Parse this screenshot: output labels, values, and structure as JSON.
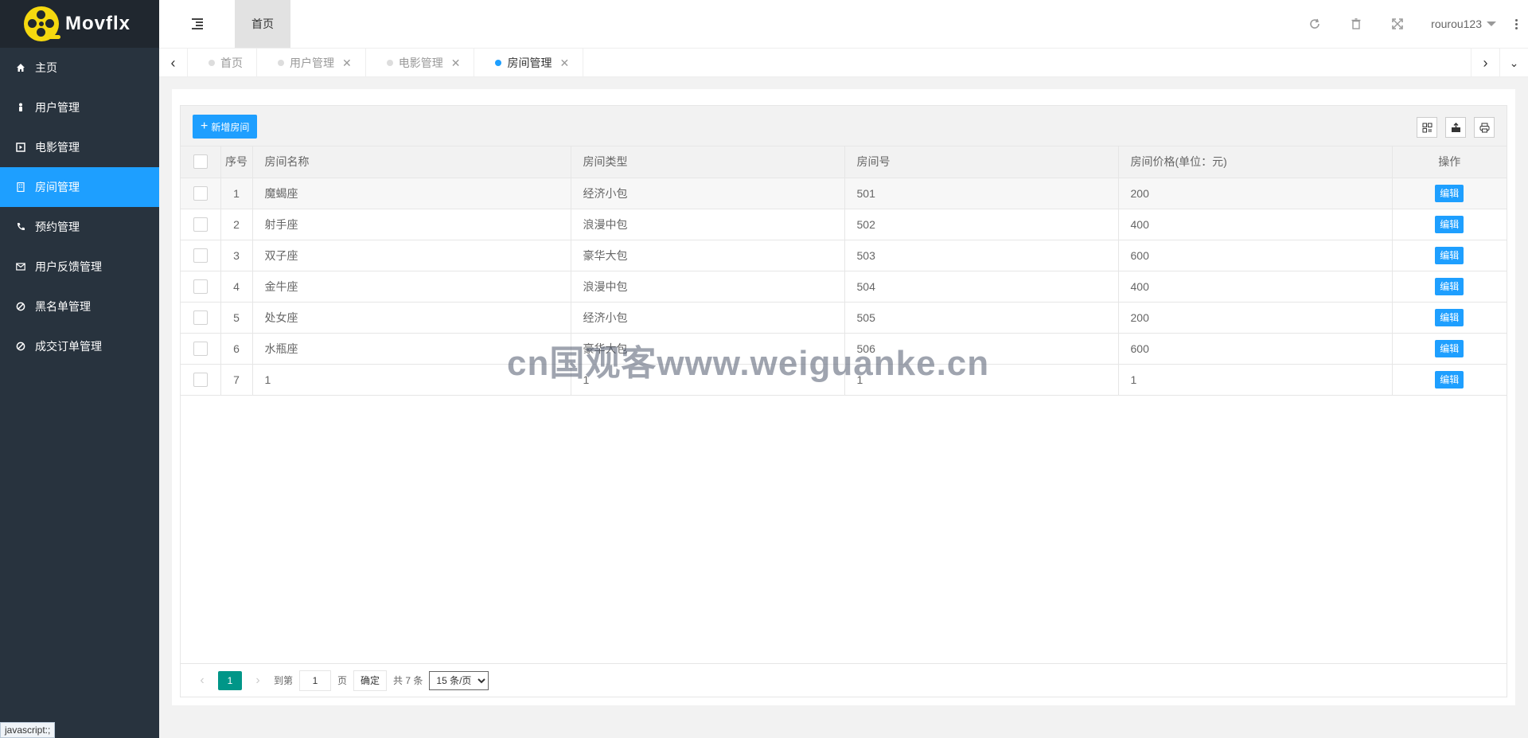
{
  "app": {
    "name": "Movflx"
  },
  "sidebar": {
    "items": [
      {
        "label": "主页",
        "icon": "home-icon"
      },
      {
        "label": "用户管理",
        "icon": "user-icon"
      },
      {
        "label": "电影管理",
        "icon": "film-icon"
      },
      {
        "label": "房间管理",
        "icon": "building-icon",
        "active": true
      },
      {
        "label": "预约管理",
        "icon": "phone-icon"
      },
      {
        "label": "用户反馈管理",
        "icon": "mail-icon"
      },
      {
        "label": "黑名单管理",
        "icon": "ban-icon"
      },
      {
        "label": "成交订单管理",
        "icon": "ban-icon"
      }
    ]
  },
  "header": {
    "home_tab": "首页",
    "user": "rourou123"
  },
  "tabs": [
    {
      "label": "首页"
    },
    {
      "label": "用户管理"
    },
    {
      "label": "电影管理"
    },
    {
      "label": "房间管理",
      "active": true
    }
  ],
  "toolbar": {
    "add_label": "新增房间"
  },
  "table": {
    "headers": [
      "序号",
      "房间名称",
      "房间类型",
      "房间号",
      "房间价格(单位：元)",
      "操作"
    ],
    "rows": [
      {
        "no": "1",
        "name": "魔蝎座",
        "type": "经济小包",
        "room": "501",
        "price": "200"
      },
      {
        "no": "2",
        "name": "射手座",
        "type": "浪漫中包",
        "room": "502",
        "price": "400"
      },
      {
        "no": "3",
        "name": "双子座",
        "type": "豪华大包",
        "room": "503",
        "price": "600"
      },
      {
        "no": "4",
        "name": "金牛座",
        "type": "浪漫中包",
        "room": "504",
        "price": "400"
      },
      {
        "no": "5",
        "name": "处女座",
        "type": "经济小包",
        "room": "505",
        "price": "200"
      },
      {
        "no": "6",
        "name": "水瓶座",
        "type": "豪华大包",
        "room": "506",
        "price": "600"
      },
      {
        "no": "7",
        "name": "1",
        "type": "1",
        "room": "1",
        "price": "1"
      }
    ],
    "edit_label": "编辑"
  },
  "pager": {
    "current": "1",
    "goto_label": "到第",
    "page_value": "1",
    "page_unit": "页",
    "confirm": "确定",
    "total": "共 7 条",
    "page_size": "15 条/页"
  },
  "watermark": "cn国观客www.weiguanke.cn",
  "status_bar": "javascript:;"
}
